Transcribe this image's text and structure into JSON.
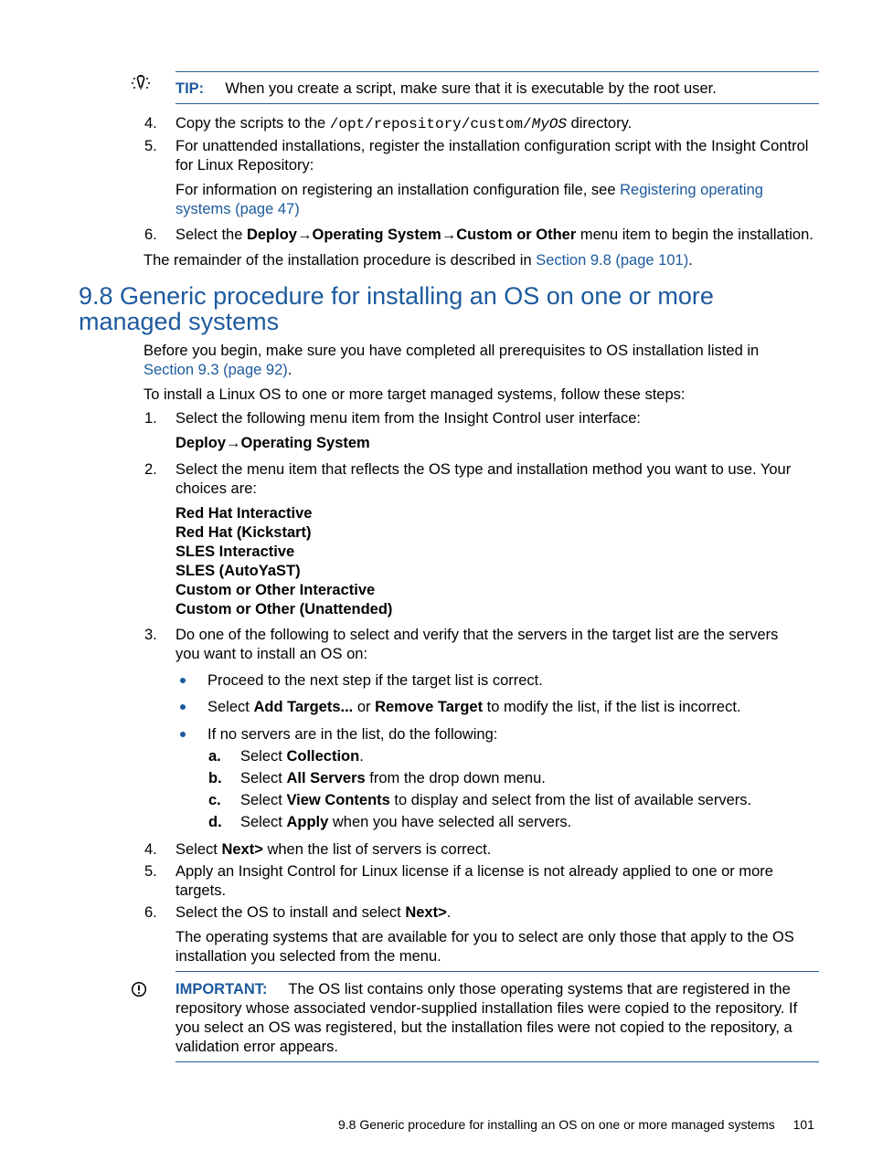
{
  "tip": {
    "icon": "lightbulb-icon",
    "label": "TIP:",
    "text": "When you create a script, make sure that it is executable by the root user."
  },
  "pre_steps": [
    {
      "num": "4.",
      "text_before": "Copy the scripts to the ",
      "code": "/opt/repository/custom/",
      "code_italic": "MyOS",
      "text_after": " directory."
    },
    {
      "num": "5.",
      "text": "For unattended installations, register the installation configuration script with the Insight Control for Linux Repository:",
      "note_before": "For information on registering an installation configuration file, see ",
      "note_link": "Registering operating systems (page 47)"
    },
    {
      "num": "6.",
      "text_before": "Select the ",
      "bold": "Deploy→Operating System→Custom or Other",
      "text_after": " menu item to begin the installation."
    }
  ],
  "remainder": {
    "text_before": "The remainder of the installation procedure is described in ",
    "link": "Section 9.8 (page 101)",
    "text_after": "."
  },
  "section": {
    "title": "9.8 Generic procedure for installing an OS on one or more managed systems",
    "intro_before": "Before you begin, make sure you have completed all prerequisites to OS installation listed in ",
    "intro_link": "Section 9.3 (page 92)",
    "intro_after": ".",
    "lead": "To install a Linux OS to one or more target managed systems, follow these steps:"
  },
  "steps": {
    "s1": {
      "num": "1.",
      "text": "Select the following menu item from the Insight Control user interface:",
      "menu": "Deploy→Operating System"
    },
    "s2": {
      "num": "2.",
      "text": "Select the menu item that reflects the OS type and installation method you want to use. Your choices are:",
      "choices": [
        "Red Hat Interactive",
        "Red Hat (Kickstart)",
        "SLES Interactive",
        "SLES (AutoYaST)",
        "Custom or Other Interactive",
        "Custom or Other (Unattended)"
      ]
    },
    "s3": {
      "num": "3.",
      "text": "Do one of the following to select and verify that the servers in the target list are the servers you want to install an OS on:",
      "bullets": {
        "b1": "Proceed to the next step if the target list is correct.",
        "b2": {
          "pre": "Select ",
          "bold1": "Add Targets...",
          "mid": " or ",
          "bold2": "Remove Target",
          "post": " to modify the list, if the list is incorrect."
        },
        "b3": "If no servers are in the list, do the following:"
      },
      "substeps": [
        {
          "letter": "a.",
          "pre": "Select ",
          "bold": "Collection",
          "post": "."
        },
        {
          "letter": "b.",
          "pre": "Select ",
          "bold": "All Servers",
          "post": " from the drop down menu."
        },
        {
          "letter": "c.",
          "pre": "Select ",
          "bold": "View Contents",
          "post": " to display and select from the list of available servers."
        },
        {
          "letter": "d.",
          "pre": "Select ",
          "bold": "Apply",
          "post": " when you have selected all servers."
        }
      ]
    },
    "s4": {
      "num": "4.",
      "pre": "Select ",
      "bold": "Next>",
      "post": " when the list of servers is correct."
    },
    "s5": {
      "num": "5.",
      "text": "Apply an Insight Control for Linux license if a license is not already applied to one or more targets."
    },
    "s6": {
      "num": "6.",
      "pre": "Select the OS to install and select ",
      "bold": "Next>",
      "post": ".",
      "note": "The operating systems that are available for you to select are only those that apply to the OS installation you selected from the menu."
    }
  },
  "important": {
    "icon": "exclamation-circle-icon",
    "label": "IMPORTANT:",
    "text": "The OS list contains only those operating systems that are registered in the repository whose associated vendor-supplied installation files were copied to the repository. If you select an OS was registered, but the installation files were not copied to the repository, a validation error appears."
  },
  "footer": {
    "title": "9.8 Generic procedure for installing an OS on one or more managed systems",
    "page": "101"
  }
}
